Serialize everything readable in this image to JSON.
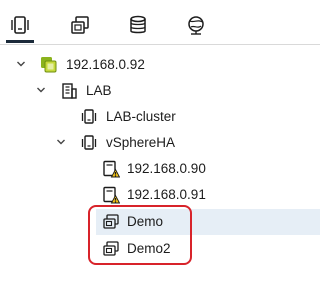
{
  "toolbar": {
    "tabs": [
      {
        "name": "hosts-and-clusters",
        "icon": "hosts-clusters-icon",
        "active": true
      },
      {
        "name": "vms-and-templates",
        "icon": "vms-templates-icon",
        "active": false
      },
      {
        "name": "storage",
        "icon": "database-icon",
        "active": false
      },
      {
        "name": "networking",
        "icon": "globe-network-icon",
        "active": false
      }
    ]
  },
  "tree": {
    "vcenter": {
      "label": "192.168.0.92",
      "icon": "vcenter-icon",
      "expanded": true
    },
    "datacenter": {
      "label": "LAB",
      "icon": "datacenter-icon",
      "expanded": true
    },
    "cluster1": {
      "label": "LAB-cluster",
      "icon": "cluster-icon"
    },
    "cluster2": {
      "label": "vSphereHA",
      "icon": "cluster-icon",
      "expanded": true
    },
    "host1": {
      "label": "192.168.0.90",
      "icon": "host-warning-icon"
    },
    "host2": {
      "label": "192.168.0.91",
      "icon": "host-warning-icon"
    },
    "vm1": {
      "label": "Demo",
      "icon": "vm-icon",
      "selected": true
    },
    "vm2": {
      "label": "Demo2",
      "icon": "vm-icon"
    }
  },
  "colors": {
    "selection": "#e6eef6",
    "highlight_border": "#d8232a",
    "warning": "#f5c518",
    "vcenter_icon": "#8bb31d"
  }
}
